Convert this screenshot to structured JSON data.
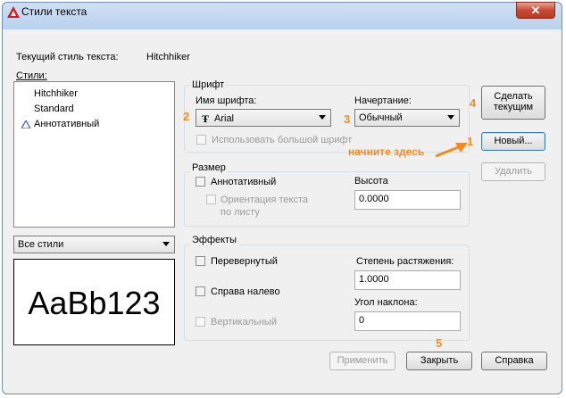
{
  "window": {
    "title": "Стили текста",
    "close_glyph": "✕"
  },
  "current_style": {
    "label": "Текущий стиль текста:",
    "value": "Hitchhiker"
  },
  "styles": {
    "label": "Стили:",
    "items": [
      "Hitchhiker",
      "Standard",
      "Аннотативный"
    ],
    "filter": "Все стили",
    "preview": "AaBb123"
  },
  "font": {
    "legend": "Шрифт",
    "name_label": "Имя шрифта:",
    "name_value": "Arial",
    "style_label": "Начертание:",
    "style_value": "Обычный",
    "bigfont_label": "Использовать большой шрифт"
  },
  "size": {
    "legend": "Размер",
    "annotative_label": "Аннотативный",
    "orient_label_1": "Ориентация текста",
    "orient_label_2": "по листу",
    "height_label": "Высота",
    "height_value": "0.0000"
  },
  "effects": {
    "legend": "Эффекты",
    "upside_label": "Перевернутый",
    "backwards_label": "Справа налево",
    "vertical_label": "Вертикальный",
    "width_label": "Степень растяжения:",
    "width_value": "1.0000",
    "oblique_label": "Угол наклона:",
    "oblique_value": "0"
  },
  "buttons": {
    "set_current_1": "Сделать",
    "set_current_2": "текущим",
    "new": "Новый...",
    "delete": "Удалить",
    "apply": "Применить",
    "close": "Закрыть",
    "help": "Справка"
  },
  "annotations": {
    "n1": "1",
    "n2": "2",
    "n3": "3",
    "n4": "4",
    "n5": "5",
    "start_here": "начните здесь"
  },
  "colors": {
    "annotation": "#f58a1f",
    "app_icon": "#d71920",
    "close_button": "#c84a34"
  }
}
